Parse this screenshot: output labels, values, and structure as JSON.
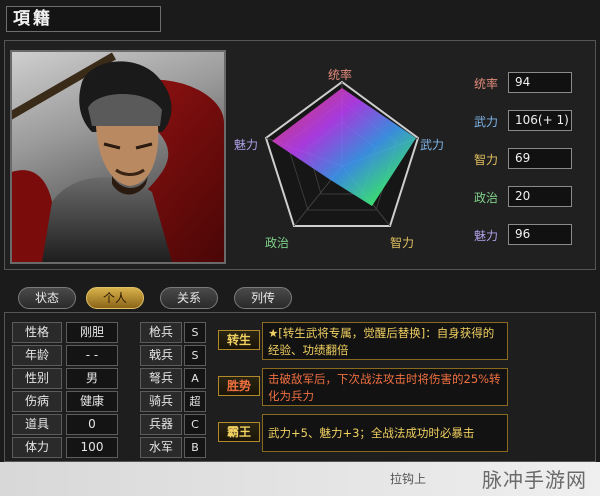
{
  "general": {
    "name": "項籍"
  },
  "radar": {
    "labels": {
      "top": "统率",
      "right": "武力",
      "bottom_right": "智力",
      "bottom_left": "政治",
      "left": "魅力"
    }
  },
  "stats": [
    {
      "label": "统率",
      "value": "94",
      "color": "#e08a7a"
    },
    {
      "label": "武力",
      "value": "106(+ 1)",
      "color": "#7fb4e8"
    },
    {
      "label": "智力",
      "value": "69",
      "color": "#e0c060"
    },
    {
      "label": "政治",
      "value": "20",
      "color": "#7fd08a"
    },
    {
      "label": "魅力",
      "value": "96",
      "color": "#b0a0e8"
    }
  ],
  "tabs": [
    "状态",
    "个人",
    "关系",
    "列传"
  ],
  "active_tab": "个人",
  "personal": [
    {
      "label": "性格",
      "value": "刚胆"
    },
    {
      "label": "年龄",
      "value": "- -"
    },
    {
      "label": "性别",
      "value": "男"
    },
    {
      "label": "伤病",
      "value": "健康"
    },
    {
      "label": "道具",
      "value": "0"
    },
    {
      "label": "体力",
      "value": "100"
    }
  ],
  "troops": [
    {
      "label": "枪兵",
      "grade": "S"
    },
    {
      "label": "戟兵",
      "grade": "S"
    },
    {
      "label": "弩兵",
      "grade": "A"
    },
    {
      "label": "骑兵",
      "grade": "超"
    },
    {
      "label": "兵器",
      "grade": "C"
    },
    {
      "label": "水军",
      "grade": "B"
    }
  ],
  "skills": [
    {
      "tag": "转生",
      "tag_color": "#f0d060",
      "desc": "★[转生武将专属，觉醒后替换]：自身获得的经验、功绩翻倍",
      "desc_color": "#f0d060"
    },
    {
      "tag": "胜势",
      "tag_color": "#f07040",
      "desc": "击破敌军后，下次战法攻击时将伤害的25%转化为兵力",
      "desc_color": "#f07040"
    },
    {
      "tag": "霸王",
      "tag_color": "#f0d060",
      "desc": "武力+5、魅力+3；全战法成功时必暴击",
      "desc_color": "#f0d060"
    }
  ],
  "watermark": {
    "small": "拉钩上",
    "big": "脉冲手游网"
  }
}
